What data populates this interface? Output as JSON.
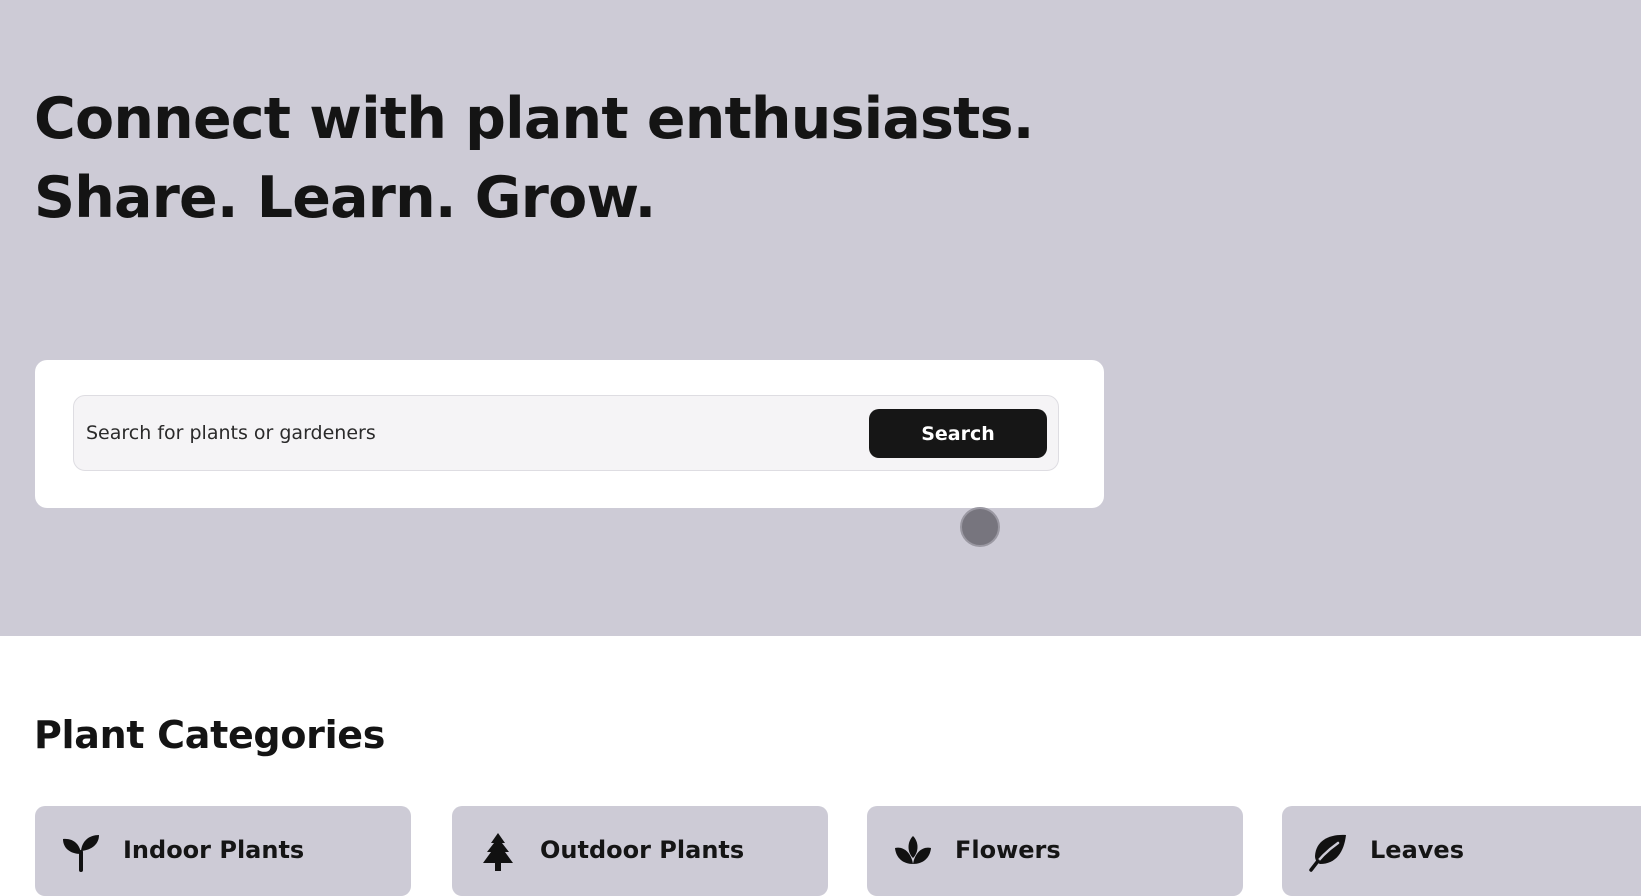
{
  "hero": {
    "title_line1": "Connect with plant enthusiasts.",
    "title_line2": "Share. Learn. Grow.",
    "background_color": "#cdcbd6"
  },
  "search": {
    "placeholder": "Search for plants or gardeners",
    "value": "",
    "button_label": "Search"
  },
  "categories_section": {
    "title": "Plant Categories",
    "items": [
      {
        "label": "Indoor Plants",
        "icon": "seedling-icon"
      },
      {
        "label": "Outdoor Plants",
        "icon": "tree-icon"
      },
      {
        "label": "Flowers",
        "icon": "lotus-flower-icon"
      },
      {
        "label": "Leaves",
        "icon": "leaf-icon"
      }
    ]
  },
  "colors": {
    "accent_dark": "#161616",
    "card_background": "#cdcbd6",
    "page_background": "#ffffff"
  }
}
